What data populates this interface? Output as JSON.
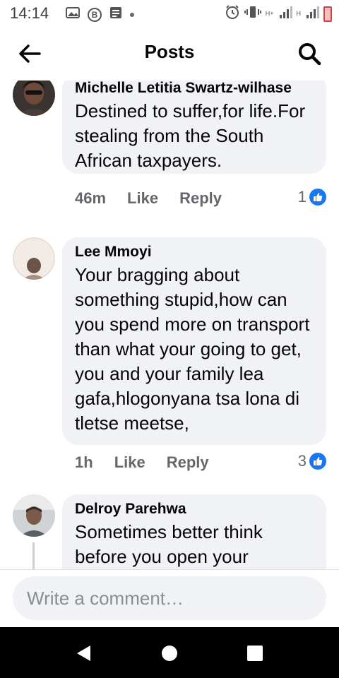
{
  "status_bar": {
    "time": "14:14",
    "icons_left": [
      "gallery-icon",
      "b-app-icon",
      "news-icon",
      "dot-icon"
    ],
    "icons_right": [
      "alarm-icon",
      "vibrate-icon",
      "signal-icon",
      "signal-icon",
      "battery-icon"
    ],
    "net1": "H+",
    "net2": "H"
  },
  "header": {
    "title": "Posts"
  },
  "comments": [
    {
      "author": "Michelle Letitia Swartz-wilhase",
      "text": "Destined to suffer,for life.For stealing from the South African taxpayers.",
      "time": "46m",
      "like_label": "Like",
      "reply_label": "Reply",
      "reactions": "1"
    },
    {
      "author": "Lee Mmoyi",
      "text": "Your bragging about something stupid,how can you spend more on transport than what your going to get, you and your family lea gafa,hlogonyana tsa lona di tletse meetse,",
      "time": "1h",
      "like_label": "Like",
      "reply_label": "Reply",
      "reactions": "3"
    },
    {
      "author": "Delroy Parehwa",
      "text": "Sometimes better think before you open your"
    }
  ],
  "composer": {
    "placeholder": "Write a comment…"
  },
  "colors": {
    "accent": "#1877f2",
    "bubble": "#f0f2f5",
    "meta": "#65676b"
  }
}
